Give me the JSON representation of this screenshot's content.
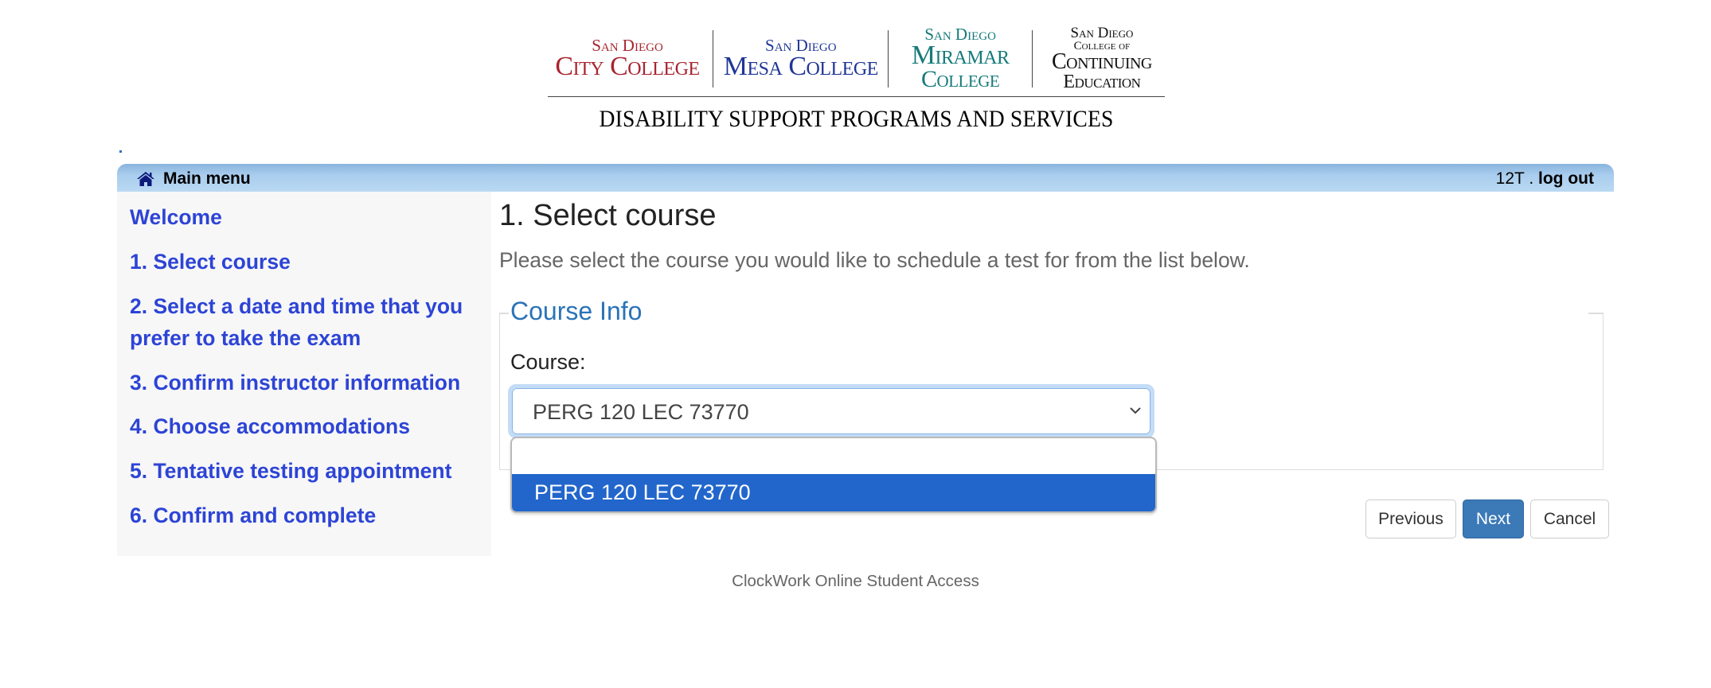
{
  "header": {
    "logos": [
      {
        "top": "San Diego",
        "main": "City College",
        "color": "#a8242f"
      },
      {
        "top": "San Diego",
        "main": "Mesa College",
        "color": "#1f3696"
      },
      {
        "top": "San Diego",
        "main": "Miramar",
        "bottom": "College",
        "color": "#167a7a"
      },
      {
        "top": "San Diego",
        "mid": "College of",
        "main": "Continuing",
        "bottom": "Education",
        "color": "#111111"
      }
    ],
    "program_title": "Disability Support Programs and Services"
  },
  "menu_bar": {
    "home_icon": "home-icon",
    "home_label": "Main menu",
    "user": "12T",
    "separator": ".",
    "logout_label": "log out"
  },
  "sidebar": {
    "items": [
      {
        "label": "Welcome"
      },
      {
        "label": "1. Select course"
      },
      {
        "label": "2. Select a date and time that you prefer to take the exam"
      },
      {
        "label": "3. Confirm instructor information"
      },
      {
        "label": "4. Choose accommodations"
      },
      {
        "label": "5. Tentative testing appointment"
      },
      {
        "label": "6. Confirm and complete"
      }
    ]
  },
  "main": {
    "title": "1. Select course",
    "description": "Please select the course you would like to schedule a test for from the list below.",
    "fieldset_legend": "Course Info",
    "course_label": "Course:",
    "course_select": {
      "value": "PERG 120 LEC 73770",
      "options": [
        "",
        "PERG 120 LEC 73770"
      ],
      "highlighted_option": "PERG 120 LEC 73770",
      "open": true
    },
    "buttons": {
      "previous": "Previous",
      "next": "Next",
      "cancel": "Cancel"
    }
  },
  "footer": {
    "text": "ClockWork Online Student Access"
  },
  "colors": {
    "link_blue": "#2d44d6",
    "legend_blue": "#2a73b8",
    "primary_button": "#3b79b7",
    "option_highlight": "#2266cc",
    "menu_bar_gradient_top": "#89b4dc",
    "menu_bar_gradient_bottom": "#bad9f3"
  }
}
